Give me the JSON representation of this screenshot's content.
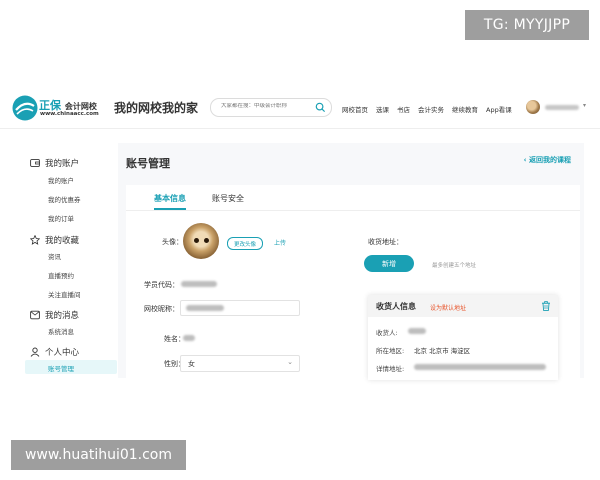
{
  "watermarks": {
    "top": "TG: MYYJJPP",
    "bottom": "www.huatihui01.com"
  },
  "header": {
    "brand_name": "正保",
    "brand_sub": "会计网校",
    "brand_url": "www.chinaacc.com",
    "site_title": "我的网校我的家",
    "search_placeholder": "大家都在搜：中级会计职称",
    "nav": [
      "网校首页",
      "选课",
      "书店",
      "会计实务",
      "继续教育",
      "App看课"
    ]
  },
  "sidebar": {
    "groups": [
      {
        "label": "我的账户",
        "icon": "wallet-icon",
        "items": [
          "我的账户",
          "我的优惠券",
          "我的订单"
        ]
      },
      {
        "label": "我的收藏",
        "icon": "star-icon",
        "items": [
          "资讯",
          "直播预约",
          "关注直播间"
        ]
      },
      {
        "label": "我的消息",
        "icon": "message-icon",
        "items": [
          "系统消息"
        ]
      },
      {
        "label": "个人中心",
        "icon": "user-icon",
        "items": [
          "账号管理"
        ]
      }
    ],
    "active_item": "账号管理"
  },
  "main": {
    "page_title": "账号管理",
    "back_link": "返回我的课程",
    "tabs": [
      "基本信息",
      "账号安全"
    ],
    "active_tab": "基本信息",
    "form": {
      "avatar_label": "头像：",
      "change_avatar": "更改头像",
      "upload": "上传",
      "student_code_label": "学员代码：",
      "nickname_label": "网校昵称：",
      "name_label": "姓名：",
      "gender_label": "性别：",
      "gender_value": "女"
    },
    "address": {
      "label": "收货地址：",
      "new_button": "新增",
      "hint": "最多创建五个地址",
      "card_title": "收货人信息",
      "set_default": "设为默认地址",
      "receiver_label": "收货人:",
      "region_label": "所在地区:",
      "region_value": "北京 北京市 海淀区",
      "detail_label": "详情地址:"
    }
  },
  "colors": {
    "accent": "#1aa0b4",
    "warning": "#e8542a"
  }
}
